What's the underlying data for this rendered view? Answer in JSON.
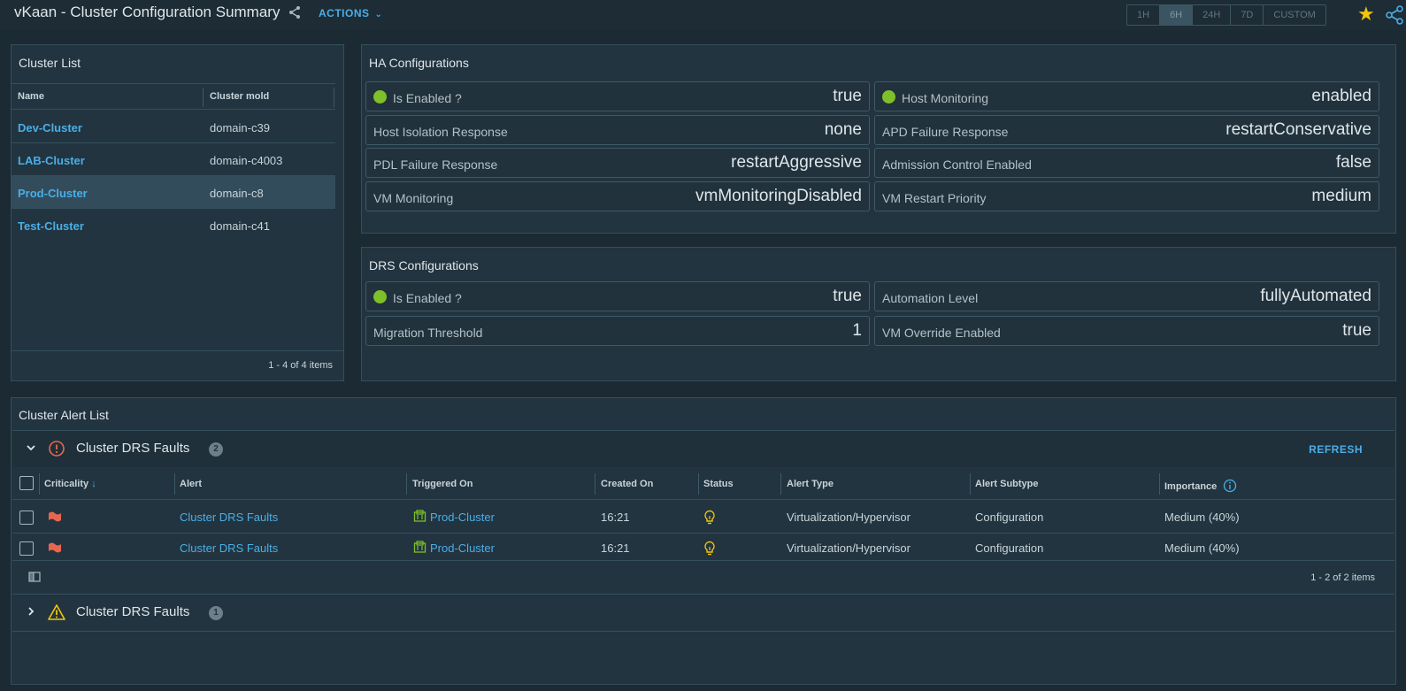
{
  "header": {
    "title": "vKaan - Cluster Configuration Summary",
    "actions_label": "ACTIONS",
    "time_ranges": [
      "1H",
      "6H",
      "24H",
      "7D",
      "CUSTOM"
    ],
    "active_range": "6H",
    "icons": {
      "share": "share-icon",
      "favorite": "star-icon",
      "share_alt": "share-nodes-icon"
    },
    "star_color": "#f2c50e"
  },
  "cluster_list": {
    "title": "Cluster List",
    "columns": [
      "Name",
      "Cluster mold"
    ],
    "rows": [
      {
        "name": "Dev-Cluster",
        "mold": "domain-c39"
      },
      {
        "name": "LAB-Cluster",
        "mold": "domain-c4003"
      },
      {
        "name": "Prod-Cluster",
        "mold": "domain-c8"
      },
      {
        "name": "Test-Cluster",
        "mold": "domain-c41"
      }
    ],
    "selected_index": 2,
    "footer": "1 - 4 of 4 items"
  },
  "ha": {
    "title": "HA Configurations",
    "items": [
      {
        "label": "Is Enabled ?",
        "value": "true",
        "dot": true
      },
      {
        "label": "Host Monitoring",
        "value": "enabled",
        "dot": true
      },
      {
        "label": "Host Isolation Response",
        "value": "none"
      },
      {
        "label": "APD Failure Response",
        "value": "restartConservative"
      },
      {
        "label": "PDL Failure Response",
        "value": "restartAggressive"
      },
      {
        "label": "Admission Control Enabled",
        "value": "false"
      },
      {
        "label": "VM Monitoring",
        "value": "vmMonitoringDisabled"
      },
      {
        "label": "VM Restart Priority",
        "value": "medium"
      }
    ]
  },
  "drs": {
    "title": "DRS Configurations",
    "items": [
      {
        "label": "Is Enabled ?",
        "value": "true",
        "dot": true
      },
      {
        "label": "Automation Level",
        "value": "fullyAutomated"
      },
      {
        "label": "Migration Threshold",
        "value": "1"
      },
      {
        "label": "VM Override Enabled",
        "value": "true"
      }
    ]
  },
  "alerts": {
    "title": "Cluster Alert List",
    "refresh_label": "REFRESH",
    "groups": [
      {
        "title": "Cluster DRS Faults",
        "count": "2",
        "icon": "critical-circle-icon",
        "expanded": true
      },
      {
        "title": "Cluster DRS Faults",
        "count": "1",
        "icon": "warning-triangle-icon",
        "expanded": false
      }
    ],
    "columns": [
      "Criticality",
      "Alert",
      "Triggered On",
      "Created On",
      "Status",
      "Alert Type",
      "Alert Subtype",
      "Importance"
    ],
    "rows": [
      {
        "alert": "Cluster DRS Faults",
        "triggered_on": "Prod-Cluster",
        "created_on": "16:21",
        "alert_type": "Virtualization/Hypervisor",
        "alert_subtype": "Configuration",
        "importance": "Medium (40%)"
      },
      {
        "alert": "Cluster DRS Faults",
        "triggered_on": "Prod-Cluster",
        "created_on": "16:21",
        "alert_type": "Virtualization/Hypervisor",
        "alert_subtype": "Configuration",
        "importance": "Medium (40%)"
      }
    ],
    "footer": "1 - 2 of 2 items"
  },
  "colors": {
    "link": "#4aaee8",
    "enabled_dot": "#7ec02a",
    "critical": "#e8664f",
    "warning": "#f2c50e"
  }
}
